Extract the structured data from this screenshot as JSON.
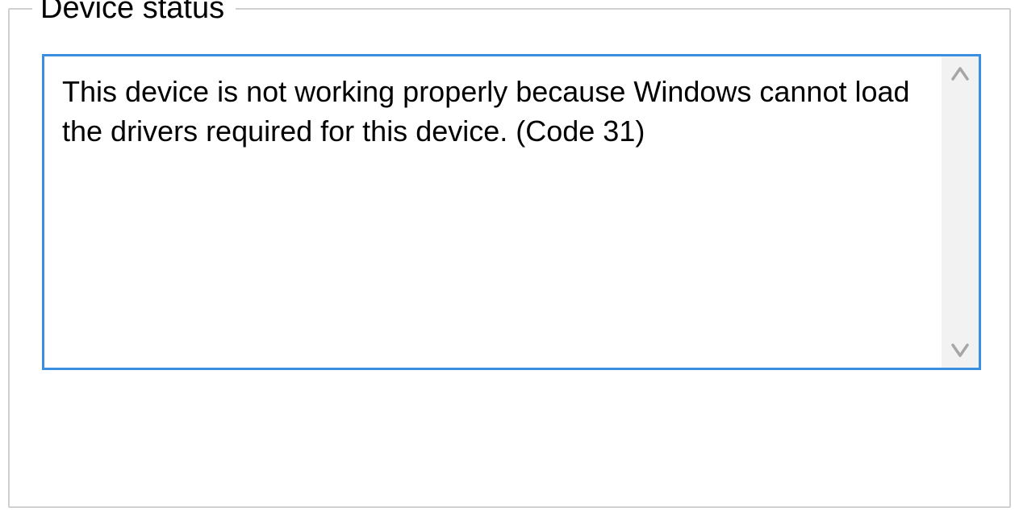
{
  "group": {
    "legend": "Device status"
  },
  "status": {
    "message": "This device is not working properly because Windows cannot load the drivers required for this device. (Code 31)"
  }
}
